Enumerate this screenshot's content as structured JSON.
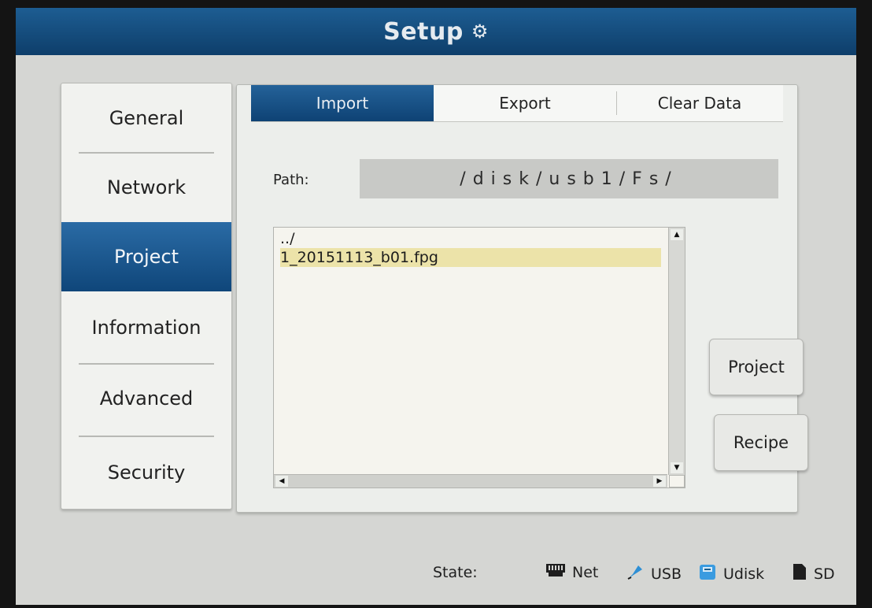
{
  "title": "Setup",
  "title_icon": "gear-icon",
  "sidebar": {
    "items": [
      {
        "label": "General",
        "active": false
      },
      {
        "label": "Network",
        "active": false
      },
      {
        "label": "Project",
        "active": true
      },
      {
        "label": "Information",
        "active": false
      },
      {
        "label": "Advanced",
        "active": false
      },
      {
        "label": "Security",
        "active": false
      }
    ]
  },
  "tabs": [
    {
      "label": "Import",
      "active": true
    },
    {
      "label": "Export",
      "active": false
    },
    {
      "label": "Clear Data",
      "active": false
    }
  ],
  "path": {
    "label": "Path:",
    "value": "/disk/usb1/Fs/"
  },
  "files": [
    {
      "name": "../",
      "selected": false
    },
    {
      "name": "1_20151113_b01.fpg",
      "selected": true
    }
  ],
  "buttons": {
    "project": "Project",
    "recipe": "Recipe"
  },
  "status": {
    "label": "State:",
    "items": [
      {
        "label": "Net",
        "icon": "ethernet-icon"
      },
      {
        "label": "USB",
        "icon": "usb-icon"
      },
      {
        "label": "Udisk",
        "icon": "udisk-icon"
      },
      {
        "label": "SD",
        "icon": "sd-card-icon"
      }
    ]
  },
  "colors": {
    "accent": "#124b7f",
    "selection": "#ece3a9",
    "usb": "#2d8fd5",
    "udisk": "#3a9be0"
  }
}
